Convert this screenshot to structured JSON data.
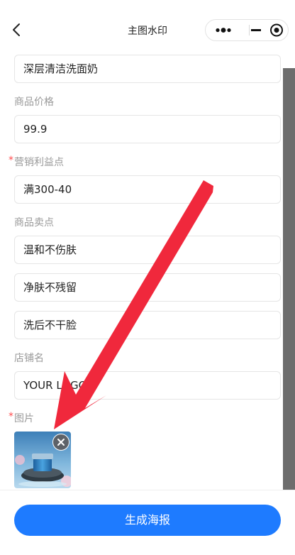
{
  "nav": {
    "title": "主图水印"
  },
  "form": {
    "product_name_value": "深层清洁洗面奶",
    "price": {
      "label": "商品价格",
      "value": "99.9"
    },
    "benefit": {
      "required_mark": "*",
      "label": "营销利益点",
      "value": "满300-40"
    },
    "selling_points": {
      "label": "商品卖点",
      "values": [
        "温和不伤肤",
        "净肤不残留",
        "洗后不干脸"
      ]
    },
    "shop_name": {
      "label": "店铺名",
      "value": "YOUR LOGO"
    },
    "image": {
      "required_mark": "*",
      "label": "图片"
    }
  },
  "bottom": {
    "generate_label": "生成海报"
  },
  "colors": {
    "primary": "#1e7bff",
    "required": "#ff4d4f",
    "annotation_arrow": "#f0283c"
  },
  "icons": [
    "back-arrow-icon",
    "more-dots-icon",
    "minimize-icon",
    "close-target-icon",
    "delete-x-icon"
  ]
}
